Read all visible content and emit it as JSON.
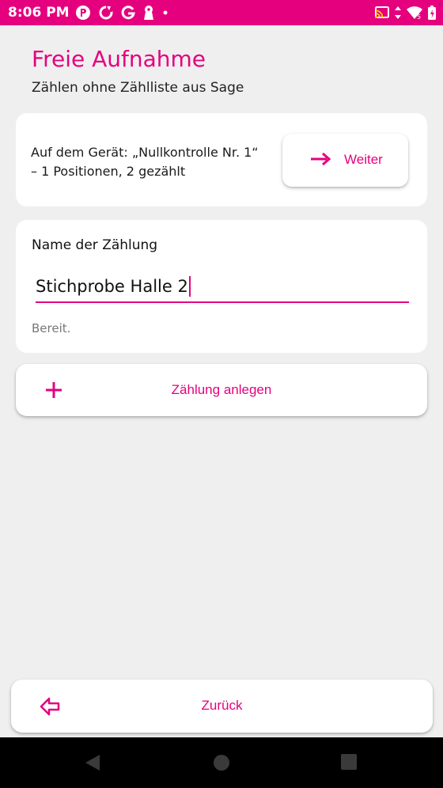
{
  "status_bar": {
    "time": "8:06 PM",
    "left_icons": [
      "app-icon-p",
      "sync-icon",
      "google-icon",
      "keyhole-icon",
      "dot-icon"
    ],
    "right_icons": [
      "cast-icon",
      "data-arrows-icon",
      "wifi-icon",
      "battery-icon"
    ]
  },
  "header": {
    "title": "Freie Aufnahme",
    "subtitle": "Zählen ohne Zählliste aus Sage"
  },
  "device_card": {
    "line1": "Auf dem Gerät: „Nullkontrolle Nr. 1“",
    "line2": "– 1 Positionen, 2 gezählt",
    "button_label": "Weiter"
  },
  "name_card": {
    "label": "Name der Zählung",
    "input_value": "Stichprobe Halle 2",
    "status": "Bereit."
  },
  "create_button": {
    "label": "Zählung anlegen"
  },
  "back_button": {
    "label": "Zurück"
  },
  "colors": {
    "accent": "#e5007e",
    "background": "#efefef",
    "card": "#ffffff",
    "nav_bar": "#000000"
  }
}
